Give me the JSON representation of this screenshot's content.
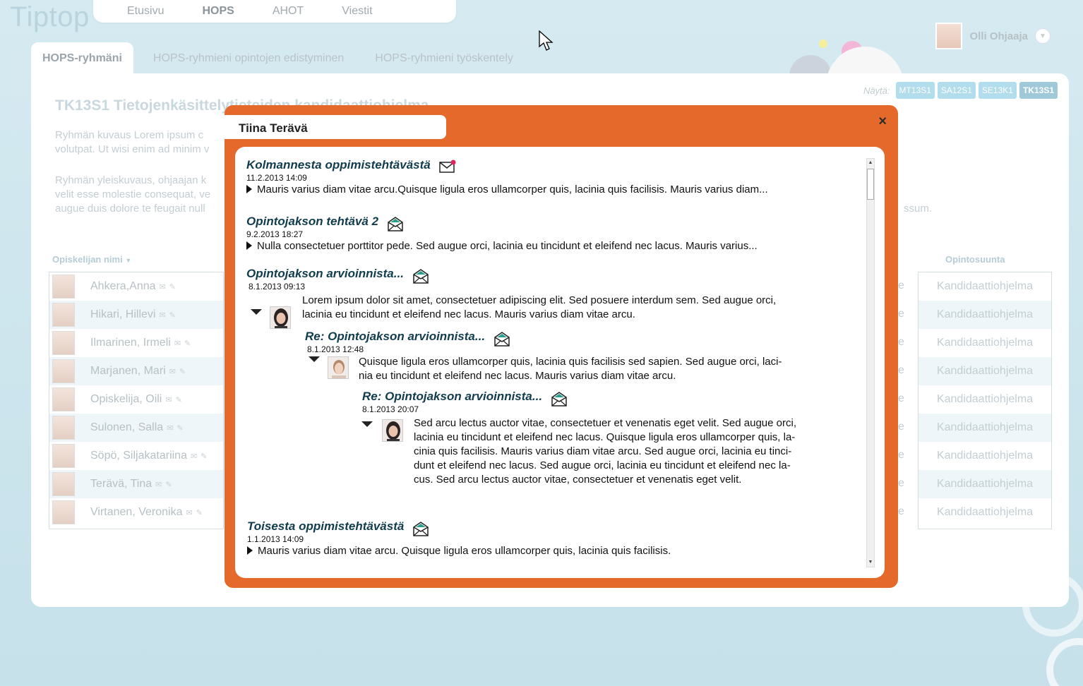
{
  "app": {
    "logo": "Tiptop"
  },
  "topnav": [
    "Etusivu",
    "HOPS",
    "AHOT",
    "Viestit"
  ],
  "topnav_active": "HOPS",
  "user": {
    "name": "Olli Ohjaaja",
    "dropdown_icon": "chevron-down-icon"
  },
  "subtabs": [
    "HOPS-ryhmäni",
    "HOPS-ryhmieni opintojen edistyminen",
    "HOPS-ryhmieni työskentely"
  ],
  "subtab_active": "HOPS-ryhmäni",
  "show": {
    "label": "Näytä:",
    "groups": [
      "MT13S1",
      "SA12S1",
      "SE13K1",
      "TK13S1"
    ],
    "active": "TK13S1"
  },
  "group": {
    "title": "TK13S1 Tietojenkäsittelytieteiden kandidaattiohjelma",
    "desc1_line1": "Ryhmän kuvaus Lorem ipsum c",
    "desc1_line2": "volutpat. Ut wisi enim ad minim v",
    "desc2_line1": "Ryhmän yleiskuvaus, ohjaajan k",
    "desc2_line2": "velit esse molestie consequat, ve",
    "desc2_line3": "augue duis dolore te feugait null",
    "desc2_tail": "ssum."
  },
  "table": {
    "col_name": "Opiskelijan nimi",
    "col_program": "Opintosuunta",
    "truncated_cell": "e",
    "students": [
      {
        "name": "Ahkera,Anna",
        "program": "Kandidaattiohjelma"
      },
      {
        "name": "Hikari, Hillevi",
        "program": "Kandidaattiohjelma"
      },
      {
        "name": "Ilmarinen, Irmeli",
        "program": "Kandidaattiohjelma"
      },
      {
        "name": "Marjanen, Mari",
        "program": "Kandidaattiohjelma"
      },
      {
        "name": "Opiskelija, Oili",
        "program": "Kandidaattiohjelma"
      },
      {
        "name": "Sulonen, Salla",
        "program": "Kandidaattiohjelma"
      },
      {
        "name": "Söpö, Siljakatariina",
        "program": "Kandidaattiohjelma"
      },
      {
        "name": "Terävä, Tina",
        "program": "Kandidaattiohjelma"
      },
      {
        "name": "Virtanen, Veronika",
        "program": "Kandidaattiohjelma"
      }
    ]
  },
  "modal": {
    "title": "Tiina Terävä",
    "close": "×",
    "messages": [
      {
        "title": "Kolmannesta oppimistehtävästä",
        "date": "11.2.2013 14:09",
        "text": "Mauris varius diam vitae arcu.Quisque ligula eros ullamcorper quis, lacinia quis facilisis. Mauris varius diam...",
        "icon": "unread-mail-icon"
      },
      {
        "title": "Opintojakson tehtävä 2",
        "date": "9.2.2013 18:27",
        "text": "Nulla consectetuer porttitor pede. Sed augue orci, lacinia eu tincidunt et eleifend nec lacus. Mauris varius...",
        "icon": "open-mail-icon"
      },
      {
        "title": "Opintojakson arvioinnista...",
        "date": "8.1.2013 09:13",
        "text_line1": "Lorem ipsum dolor sit amet, consectetuer adipiscing elit. Sed posuere interdum sem. Sed augue orci,",
        "text_line2": "lacinia eu tincidunt et eleifend nec lacus. Mauris varius diam vitae arcu.",
        "icon": "open-mail-icon"
      },
      {
        "title": "Re: Opintojakson arvioinnista...",
        "date": "8.1.2013 12:48",
        "text_line1": "Quisque ligula eros ullamcorper quis, lacinia quis facilisis sed sapien. Sed augue orci, laci-",
        "text_line2": "nia eu tincidunt et eleifend nec lacus. Mauris varius diam vitae arcu.",
        "icon": "open-mail-icon"
      },
      {
        "title": "Re: Opintojakson arvioinnista...",
        "date": "8.1.2013 20:07",
        "text_line1": "Sed arcu lectus auctor vitae, consectetuer et venenatis eget velit. Sed augue orci,",
        "text_line2": "lacinia eu tincidunt et eleifend nec lacus. Quisque ligula eros ullamcorper quis, la-",
        "text_line3": "cinia quis facilisis. Mauris varius diam vitae arcu. Sed augue orci, lacinia eu tinci-",
        "text_line4": "dunt et eleifend nec lacus. Sed augue orci, lacinia eu tincidunt et eleifend nec la-",
        "text_line5": "cus. Sed arcu lectus auctor vitae, consectetuer et venenatis eget velit.",
        "icon": "open-mail-icon"
      },
      {
        "title": "Toisesta oppimistehtävästä",
        "date": "1.1.2013 14:09",
        "text": "Mauris varius diam vitae arcu. Quisque ligula eros ullamcorper quis, lacinia quis facilisis.",
        "icon": "open-mail-icon"
      }
    ]
  },
  "colors": {
    "modal_orange": "#e5692a",
    "title_teal": "#103c4e",
    "chip_blue": "#b2dded",
    "envelope_green": "#2a9d8f"
  }
}
